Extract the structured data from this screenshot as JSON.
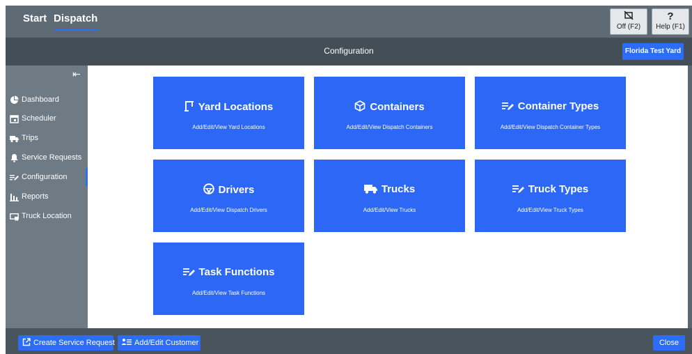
{
  "topbar": {
    "tabs": [
      {
        "label": "Start"
      },
      {
        "label": "Dispatch"
      }
    ],
    "off_label": "Off (F2)",
    "help_label": "Help (F1)",
    "help_glyph": "?"
  },
  "header": {
    "title": "Configuration",
    "yard_button": "Florida Test Yard"
  },
  "sidebar": {
    "collapse_glyph": "⇤",
    "active_item": "Configuration",
    "items": [
      {
        "label": "Dashboard",
        "icon": "pie-chart-icon"
      },
      {
        "label": "Scheduler",
        "icon": "calendar-icon"
      },
      {
        "label": "Trips",
        "icon": "truck-icon"
      },
      {
        "label": "Service Requests",
        "icon": "bell-icon"
      },
      {
        "label": "Configuration",
        "icon": "list-edit-icon"
      },
      {
        "label": "Reports",
        "icon": "bar-chart-icon"
      },
      {
        "label": "Truck Location",
        "icon": "truck-location-icon"
      }
    ]
  },
  "tiles": [
    {
      "title": "Yard Locations",
      "subtitle": "Add/Edit/View Yard Locations",
      "icon": "yard-location-icon"
    },
    {
      "title": "Containers",
      "subtitle": "Add/Edit/View Dispatch Containers",
      "icon": "box-icon"
    },
    {
      "title": "Container Types",
      "subtitle": "Add/Edit/View Dispatch Container Types",
      "icon": "list-edit-icon"
    },
    {
      "title": "Drivers",
      "subtitle": "Add/Edit/View Dispatch Drivers",
      "icon": "steering-wheel-icon"
    },
    {
      "title": "Trucks",
      "subtitle": "Add/Edit/View Trucks",
      "icon": "truck-icon"
    },
    {
      "title": "Truck Types",
      "subtitle": "Add/Edit/View Truck Types",
      "icon": "list-edit-icon"
    },
    {
      "title": "Task Functions",
      "subtitle": "Add/Edit/View Task Functions",
      "icon": "list-edit-icon"
    }
  ],
  "bottombar": {
    "create_service_request": "Create Service Request",
    "add_edit_customer": "Add/Edit Customer",
    "close": "Close"
  },
  "colors": {
    "accent": "#2c68f5",
    "topbar": "#5f6b74",
    "header": "#434e57",
    "sidebar": "#6e7a84"
  }
}
